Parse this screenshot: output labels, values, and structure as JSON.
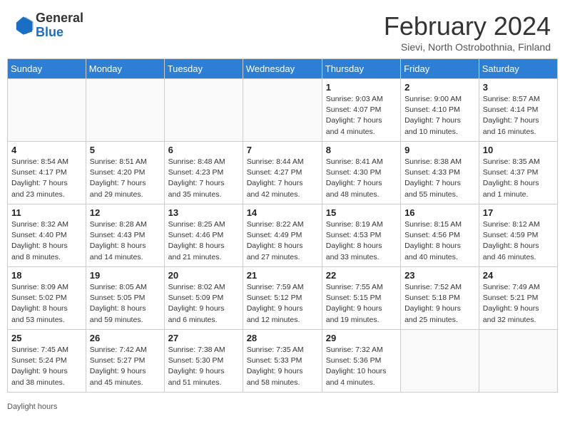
{
  "header": {
    "logo_general": "General",
    "logo_blue": "Blue",
    "month_title": "February 2024",
    "location": "Sievi, North Ostrobothnia, Finland"
  },
  "weekdays": [
    "Sunday",
    "Monday",
    "Tuesday",
    "Wednesday",
    "Thursday",
    "Friday",
    "Saturday"
  ],
  "footer": {
    "daylight_hours": "Daylight hours"
  },
  "weeks": [
    [
      {
        "day": "",
        "info": ""
      },
      {
        "day": "",
        "info": ""
      },
      {
        "day": "",
        "info": ""
      },
      {
        "day": "",
        "info": ""
      },
      {
        "day": "1",
        "info": "Sunrise: 9:03 AM\nSunset: 4:07 PM\nDaylight: 7 hours\nand 4 minutes."
      },
      {
        "day": "2",
        "info": "Sunrise: 9:00 AM\nSunset: 4:10 PM\nDaylight: 7 hours\nand 10 minutes."
      },
      {
        "day": "3",
        "info": "Sunrise: 8:57 AM\nSunset: 4:14 PM\nDaylight: 7 hours\nand 16 minutes."
      }
    ],
    [
      {
        "day": "4",
        "info": "Sunrise: 8:54 AM\nSunset: 4:17 PM\nDaylight: 7 hours\nand 23 minutes."
      },
      {
        "day": "5",
        "info": "Sunrise: 8:51 AM\nSunset: 4:20 PM\nDaylight: 7 hours\nand 29 minutes."
      },
      {
        "day": "6",
        "info": "Sunrise: 8:48 AM\nSunset: 4:23 PM\nDaylight: 7 hours\nand 35 minutes."
      },
      {
        "day": "7",
        "info": "Sunrise: 8:44 AM\nSunset: 4:27 PM\nDaylight: 7 hours\nand 42 minutes."
      },
      {
        "day": "8",
        "info": "Sunrise: 8:41 AM\nSunset: 4:30 PM\nDaylight: 7 hours\nand 48 minutes."
      },
      {
        "day": "9",
        "info": "Sunrise: 8:38 AM\nSunset: 4:33 PM\nDaylight: 7 hours\nand 55 minutes."
      },
      {
        "day": "10",
        "info": "Sunrise: 8:35 AM\nSunset: 4:37 PM\nDaylight: 8 hours\nand 1 minute."
      }
    ],
    [
      {
        "day": "11",
        "info": "Sunrise: 8:32 AM\nSunset: 4:40 PM\nDaylight: 8 hours\nand 8 minutes."
      },
      {
        "day": "12",
        "info": "Sunrise: 8:28 AM\nSunset: 4:43 PM\nDaylight: 8 hours\nand 14 minutes."
      },
      {
        "day": "13",
        "info": "Sunrise: 8:25 AM\nSunset: 4:46 PM\nDaylight: 8 hours\nand 21 minutes."
      },
      {
        "day": "14",
        "info": "Sunrise: 8:22 AM\nSunset: 4:49 PM\nDaylight: 8 hours\nand 27 minutes."
      },
      {
        "day": "15",
        "info": "Sunrise: 8:19 AM\nSunset: 4:53 PM\nDaylight: 8 hours\nand 33 minutes."
      },
      {
        "day": "16",
        "info": "Sunrise: 8:15 AM\nSunset: 4:56 PM\nDaylight: 8 hours\nand 40 minutes."
      },
      {
        "day": "17",
        "info": "Sunrise: 8:12 AM\nSunset: 4:59 PM\nDaylight: 8 hours\nand 46 minutes."
      }
    ],
    [
      {
        "day": "18",
        "info": "Sunrise: 8:09 AM\nSunset: 5:02 PM\nDaylight: 8 hours\nand 53 minutes."
      },
      {
        "day": "19",
        "info": "Sunrise: 8:05 AM\nSunset: 5:05 PM\nDaylight: 8 hours\nand 59 minutes."
      },
      {
        "day": "20",
        "info": "Sunrise: 8:02 AM\nSunset: 5:09 PM\nDaylight: 9 hours\nand 6 minutes."
      },
      {
        "day": "21",
        "info": "Sunrise: 7:59 AM\nSunset: 5:12 PM\nDaylight: 9 hours\nand 12 minutes."
      },
      {
        "day": "22",
        "info": "Sunrise: 7:55 AM\nSunset: 5:15 PM\nDaylight: 9 hours\nand 19 minutes."
      },
      {
        "day": "23",
        "info": "Sunrise: 7:52 AM\nSunset: 5:18 PM\nDaylight: 9 hours\nand 25 minutes."
      },
      {
        "day": "24",
        "info": "Sunrise: 7:49 AM\nSunset: 5:21 PM\nDaylight: 9 hours\nand 32 minutes."
      }
    ],
    [
      {
        "day": "25",
        "info": "Sunrise: 7:45 AM\nSunset: 5:24 PM\nDaylight: 9 hours\nand 38 minutes."
      },
      {
        "day": "26",
        "info": "Sunrise: 7:42 AM\nSunset: 5:27 PM\nDaylight: 9 hours\nand 45 minutes."
      },
      {
        "day": "27",
        "info": "Sunrise: 7:38 AM\nSunset: 5:30 PM\nDaylight: 9 hours\nand 51 minutes."
      },
      {
        "day": "28",
        "info": "Sunrise: 7:35 AM\nSunset: 5:33 PM\nDaylight: 9 hours\nand 58 minutes."
      },
      {
        "day": "29",
        "info": "Sunrise: 7:32 AM\nSunset: 5:36 PM\nDaylight: 10 hours\nand 4 minutes."
      },
      {
        "day": "",
        "info": ""
      },
      {
        "day": "",
        "info": ""
      }
    ]
  ]
}
